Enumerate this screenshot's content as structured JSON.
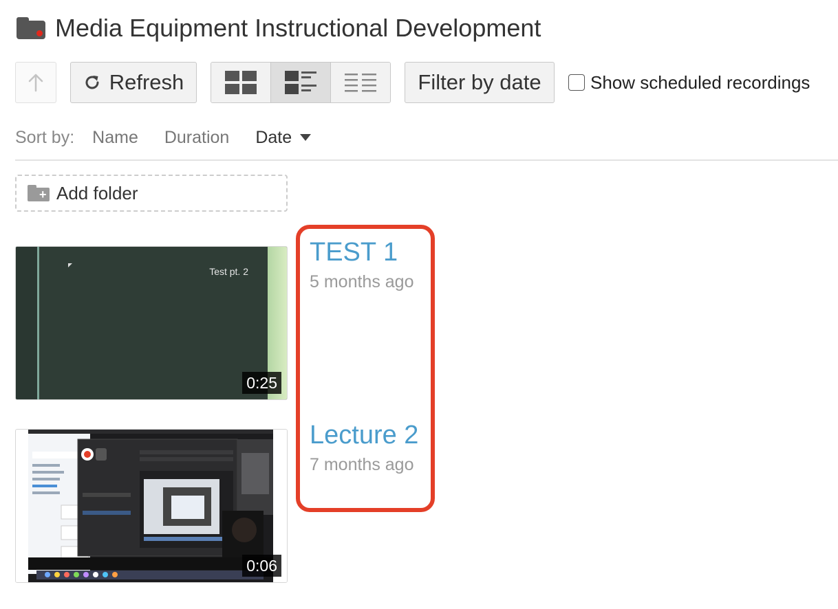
{
  "header": {
    "title": "Media Equipment Instructional Development",
    "colors": {
      "folder": "#555555",
      "folder_dot": "#e0281c"
    }
  },
  "toolbar": {
    "up_icon": "arrow-up-icon",
    "refresh_label": "Refresh",
    "refresh_icon": "refresh-icon",
    "view_modes": [
      "thumbnail-grid",
      "detailed-list",
      "compact-list"
    ],
    "active_view": "detailed-list",
    "filter_label": "Filter by date",
    "scheduled_label": "Show scheduled recordings",
    "scheduled_checked": false
  },
  "sort": {
    "label": "Sort by:",
    "options": [
      "Name",
      "Duration",
      "Date"
    ],
    "active": "Date",
    "direction": "descending"
  },
  "add_folder": {
    "label": "Add folder"
  },
  "sessions": [
    {
      "title": "TEST 1",
      "age": "5 months ago",
      "duration": "0:25",
      "thumb_caption": "Test pt. 2"
    },
    {
      "title": "Lecture 2",
      "age": "7 months ago",
      "duration": "0:06"
    }
  ],
  "colors": {
    "link": "#4a9ccc",
    "highlight": "#e43f28",
    "muted": "#9a9a9a"
  }
}
